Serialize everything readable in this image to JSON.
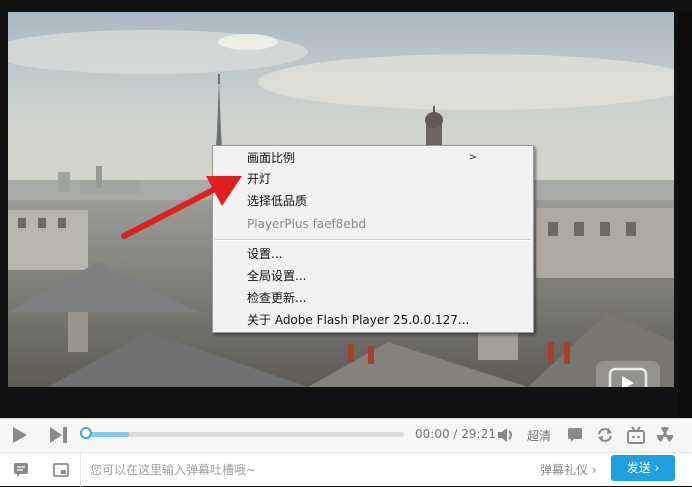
{
  "context_menu": {
    "items": [
      {
        "label": "画面比例",
        "submenu_arrow": ">",
        "enabled": true
      },
      {
        "label": "开灯",
        "enabled": true
      },
      {
        "label": "选择低品质",
        "enabled": true
      },
      {
        "label": "PlayerPlus faef8ebd",
        "enabled": false
      },
      {
        "label": "设置...",
        "enabled": true
      },
      {
        "label": "全局设置...",
        "enabled": true
      },
      {
        "label": "检查更新...",
        "enabled": true
      },
      {
        "label": "关于 Adobe Flash Player 25.0.0.127...",
        "enabled": true
      }
    ]
  },
  "controls": {
    "time": "00:00 / 29:21",
    "quality": "超清",
    "progress_buffered": 0.14,
    "progress_played": 0.0
  },
  "danmaku": {
    "placeholder": "您可以在这里输入弹幕吐槽哦~",
    "etiquette_label": "弹幕礼仪 ›",
    "send_label": "发送 ›"
  },
  "colors": {
    "accent": "#1ea0e2",
    "annotation_arrow": "#e02020",
    "icon_gray": "#8a8a8a"
  },
  "icons": [
    "play-icon",
    "next-icon",
    "volume-icon",
    "danmaku-toggle-icon",
    "loop-icon",
    "tv-icon",
    "radiation-icon",
    "chat-icon",
    "screen-icon",
    "big-play-icon"
  ]
}
